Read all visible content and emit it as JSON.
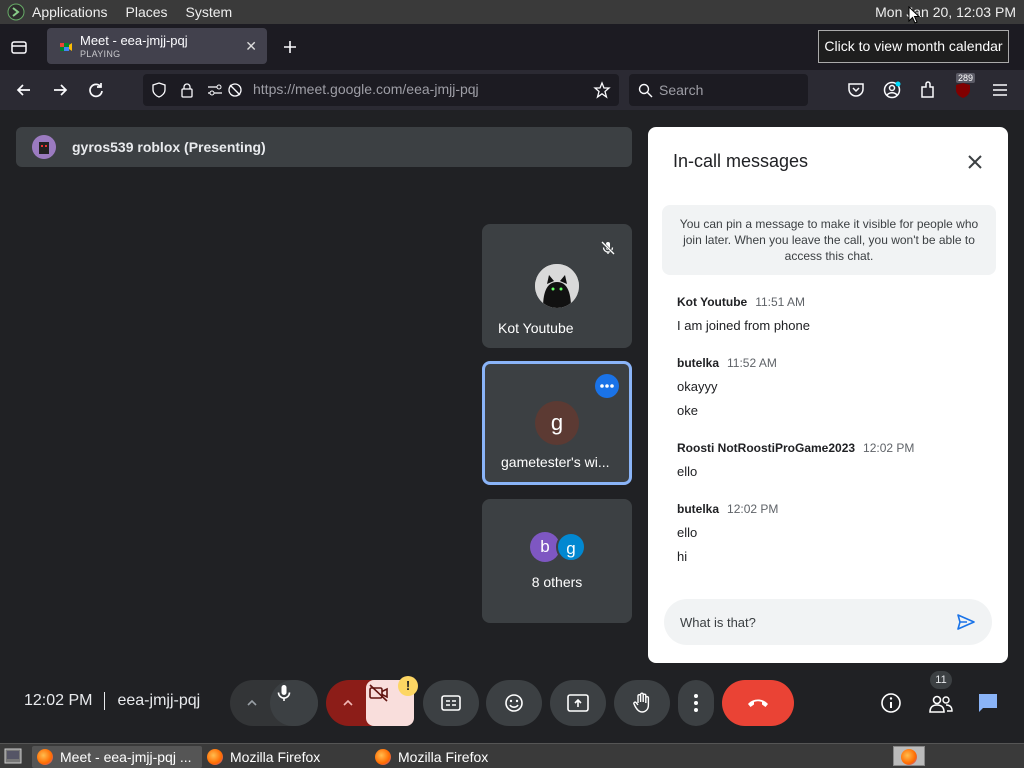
{
  "top_panel": {
    "menus": [
      "Applications",
      "Places",
      "System"
    ],
    "clock": "Mon Jan 20, 12:03 PM",
    "tooltip": "Click to view month calendar"
  },
  "browser": {
    "tab": {
      "title": "Meet - eea-jmjj-pqj",
      "status": "PLAYING"
    },
    "url_host": "https://meet.google.com",
    "url_path": "/eea-jmjj-pqj",
    "search_placeholder": "Search",
    "extension_badge": "289"
  },
  "meet": {
    "presenting_label": "gyros539 roblox (Presenting)",
    "tiles": [
      {
        "name": "Kot Youtube"
      },
      {
        "name": "gametester's wi...",
        "avatar_letter": "g"
      },
      {
        "name": "8 others",
        "avatar_letters": [
          "b",
          "g"
        ]
      }
    ],
    "time": "12:02 PM",
    "meeting_code": "eea-jmjj-pqj",
    "participants_count": "11",
    "warning_badge": "!"
  },
  "chat": {
    "title": "In-call messages",
    "info": "You can pin a message to make it visible for people who join later. When you leave the call, you won't be able to access this chat.",
    "messages": [
      {
        "sender": "Kot Youtube",
        "time": "11:51 AM",
        "lines": [
          "I am joined from phone"
        ]
      },
      {
        "sender": "butelka",
        "time": "11:52 AM",
        "lines": [
          "okayyy",
          "oke"
        ]
      },
      {
        "sender": "Roosti NotRoostiProGame2023",
        "time": "12:02 PM",
        "lines": [
          "ello"
        ]
      },
      {
        "sender": "butelka",
        "time": "12:02 PM",
        "lines": [
          "ello",
          "hi"
        ]
      }
    ],
    "input_value": "What is that?"
  },
  "taskbar": {
    "items": [
      "Meet - eea-jmjj-pqj ...",
      "Mozilla Firefox",
      "Mozilla Firefox"
    ]
  },
  "colors": {
    "meet_bg": "#202124",
    "tile_bg": "#3c4043",
    "active_border": "#8ab4f8",
    "end_call": "#ea4335",
    "accent_blue": "#1a73e8"
  }
}
